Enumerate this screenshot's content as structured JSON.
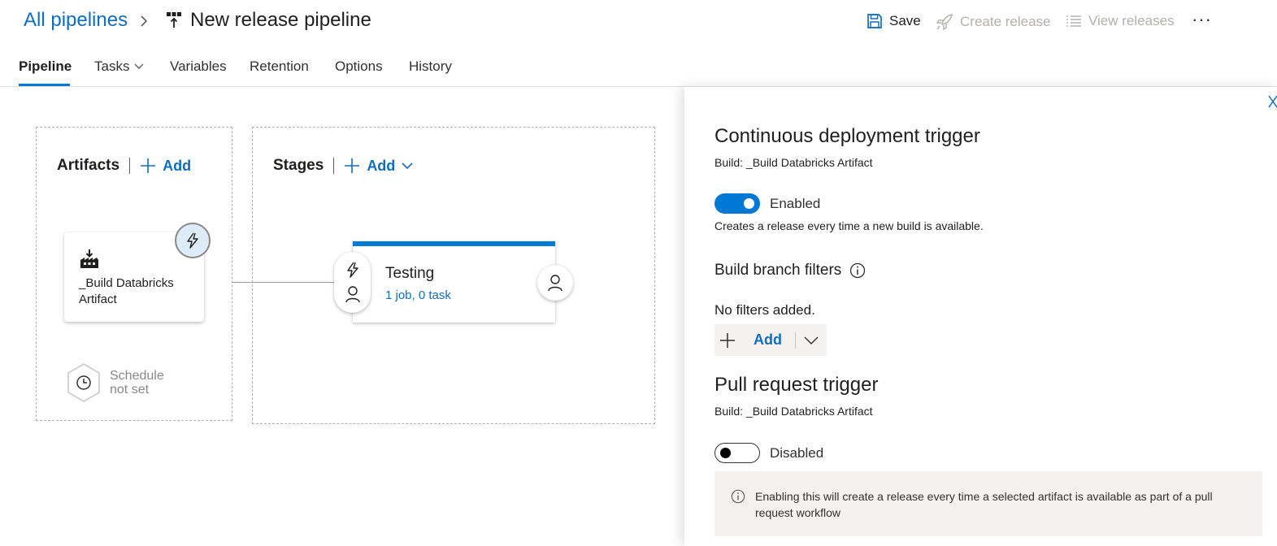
{
  "header": {
    "breadcrumb_root": "All pipelines",
    "title": "New release pipeline",
    "save_label": "Save",
    "create_release_label": "Create release",
    "view_releases_label": "View releases",
    "more_label": "···"
  },
  "tabs": [
    {
      "label": "Pipeline",
      "active": true
    },
    {
      "label": "Tasks"
    },
    {
      "label": "Variables"
    },
    {
      "label": "Retention"
    },
    {
      "label": "Options"
    },
    {
      "label": "History"
    }
  ],
  "artifacts": {
    "title": "Artifacts",
    "add_label": "Add",
    "artifact_name": "_Build Databricks Artifact",
    "schedule_line1": "Schedule",
    "schedule_line2": "not set"
  },
  "stages": {
    "title": "Stages",
    "add_label": "Add",
    "stage_name": "Testing",
    "stage_summary": "1 job, 0 task"
  },
  "panel": {
    "cd_title": "Continuous deployment trigger",
    "cd_build": "Build: _Build Databricks Artifact",
    "cd_toggle_label": "Enabled",
    "cd_enabled": true,
    "cd_description": "Creates a release every time a new build is available.",
    "branch_filters_title": "Build branch filters",
    "no_filters": "No filters added.",
    "add_filter_label": "Add",
    "pr_title": "Pull request trigger",
    "pr_build": "Build: _Build Databricks Artifact",
    "pr_toggle_label": "Disabled",
    "pr_enabled": false,
    "pr_info": "Enabling this will create a release every time a selected artifact is available as part of a pull request workflow"
  },
  "colors": {
    "accent": "#0078d4",
    "link": "#106ebe",
    "disabled_text": "#b3b0ad"
  }
}
